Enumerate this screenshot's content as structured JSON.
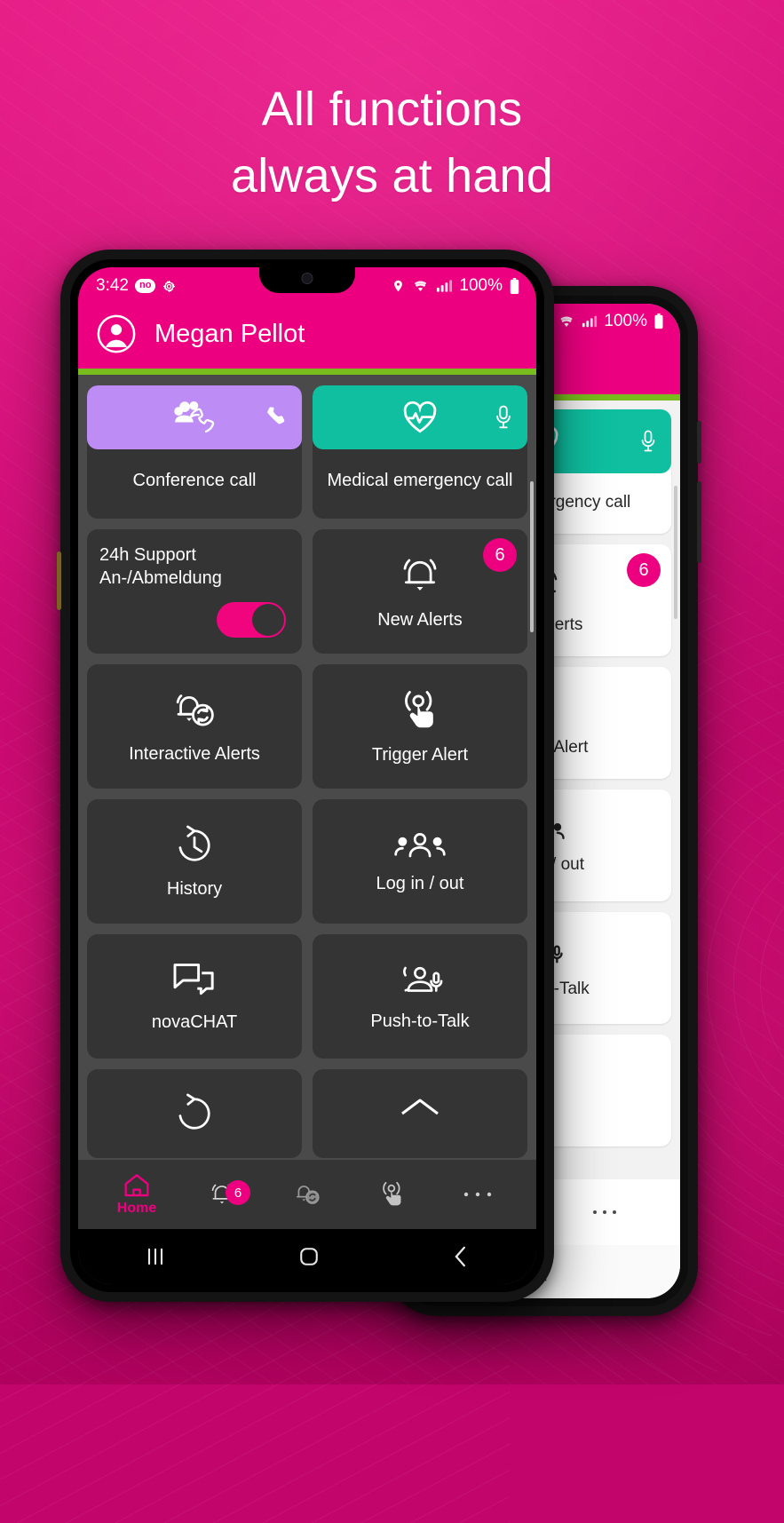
{
  "headline": {
    "line1": "All functions",
    "line2": "always at hand"
  },
  "colors": {
    "brand_magenta": "#ec0080",
    "accent_green": "#78bc1e",
    "card_dark": "#343434",
    "page_dark": "#4a4a4a",
    "conference_purple": "#bd8cf5",
    "medical_teal": "#0fbfa0",
    "background_pink": "#c2056b"
  },
  "phone_front": {
    "statusbar": {
      "time": "3:42",
      "chip": "no",
      "gear_icon": "gear-icon",
      "location_icon": "location-pin-icon",
      "wifi_icon": "wifi-icon",
      "signal_icon": "signal-bars-icon",
      "battery_text": "100%",
      "battery_icon": "battery-full-icon"
    },
    "appbar": {
      "avatar_icon": "account-circle-icon",
      "title": "Megan Pellot"
    },
    "cards": [
      {
        "label": "Conference call",
        "icon": "conference-call-icon",
        "side_icon": "phone-icon",
        "style": "banner",
        "color": "#bd8cf5"
      },
      {
        "label": "Medical emergency call",
        "icon": "heart-pulse-icon",
        "side_icon": "microphone-icon",
        "style": "banner",
        "color": "#0fbfa0"
      },
      {
        "label": "24h Support An-/Abmeldung",
        "style": "toggle",
        "toggle_on": true
      },
      {
        "label": "New Alerts",
        "icon": "bell-icon",
        "style": "tile",
        "badge": "6"
      },
      {
        "label": "Interactive Alerts",
        "icon": "bell-sync-icon",
        "style": "tile"
      },
      {
        "label": "Trigger Alert",
        "icon": "tap-alert-icon",
        "style": "tile"
      },
      {
        "label": "History",
        "icon": "history-clock-icon",
        "style": "tile"
      },
      {
        "label": "Log in / out",
        "icon": "people-group-icon",
        "style": "tile"
      },
      {
        "label": "novaCHAT",
        "icon": "chat-bubbles-icon",
        "style": "tile"
      },
      {
        "label": "Push-to-Talk",
        "icon": "push-to-talk-icon",
        "style": "tile"
      }
    ],
    "bottom_nav": [
      {
        "label": "Home",
        "icon": "home-icon",
        "active": true
      },
      {
        "label": "",
        "icon": "bell-icon",
        "badge": "6",
        "active": false
      },
      {
        "label": "",
        "icon": "bell-sync-icon",
        "active": false
      },
      {
        "label": "",
        "icon": "tap-alert-icon",
        "active": false
      },
      {
        "label": "",
        "icon": "more-horizontal-icon",
        "active": false
      }
    ],
    "android_nav": {
      "recents_icon": "recents-icon",
      "home_icon": "home-square-icon",
      "back_icon": "back-chevron-icon"
    }
  },
  "phone_back": {
    "statusbar": {
      "location_icon": "location-pin-icon",
      "wifi_icon": "wifi-icon",
      "signal_icon": "signal-bars-icon",
      "battery_text": "100%",
      "battery_icon": "battery-full-icon"
    },
    "cards": [
      {
        "label": "Medical emergency call",
        "icon": "heart-pulse-icon",
        "side_icon": "microphone-icon",
        "style": "banner",
        "color": "#0fbfa0"
      },
      {
        "label": "New Alerts",
        "icon": "bell-icon",
        "style": "tile",
        "badge": "6"
      },
      {
        "label": "Trigger Alert",
        "icon": "tap-alert-icon",
        "style": "tile"
      },
      {
        "label": "Log in / out",
        "icon": "people-group-icon",
        "style": "tile"
      },
      {
        "label": "Push-to-Talk",
        "icon": "push-to-talk-icon",
        "style": "tile"
      }
    ],
    "bottom_nav": [
      {
        "label": "",
        "icon": "tap-alert-icon"
      },
      {
        "label": "",
        "icon": "more-horizontal-icon"
      }
    ],
    "android_nav": {
      "back_icon": "back-chevron-icon"
    }
  }
}
